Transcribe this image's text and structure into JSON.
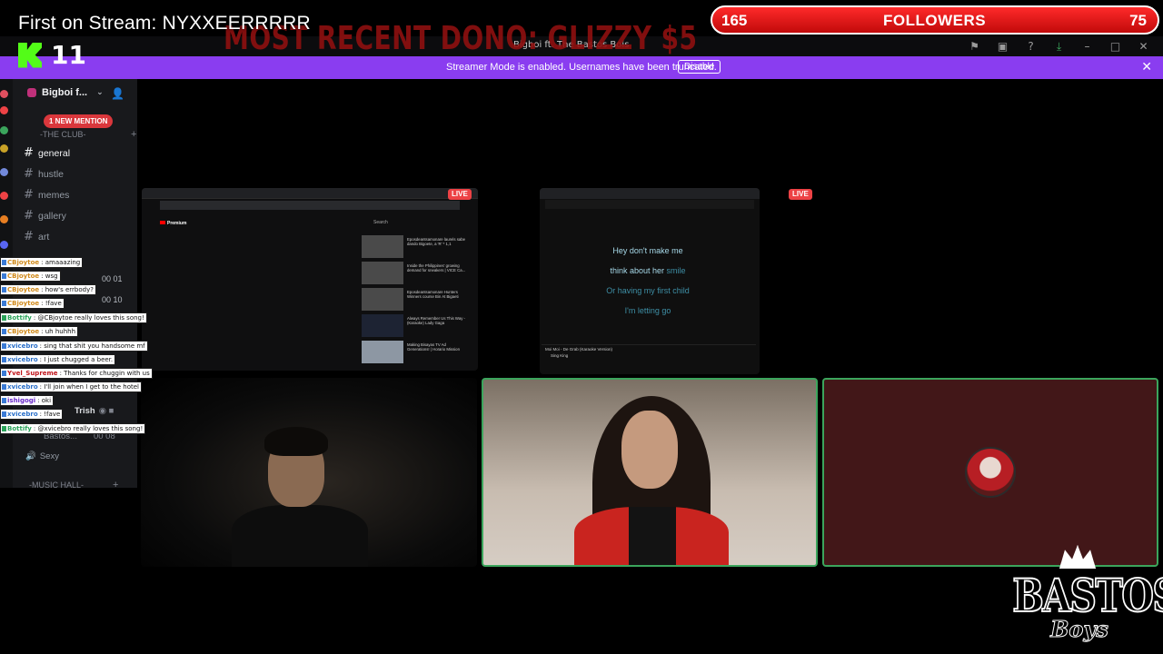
{
  "overlay": {
    "first_on_stream": "First on Stream: NYXXEERRRRR",
    "kick_count": "11",
    "recent_dono": "MOST RECENT DONO: GLIZZY $5",
    "followers": {
      "left": "165",
      "label": "FOLLOWERS",
      "right": "75"
    },
    "logo_big": "BASTOS",
    "logo_small": "Boys"
  },
  "window": {
    "title": "Bigboi ft. The Bastos Bois"
  },
  "streamer_bar": {
    "message": "Streamer Mode is enabled. Usernames have been truncated.",
    "disable_label": "Disable",
    "color": "#8a3df0"
  },
  "sidebar": {
    "server_name": "Bigboi f...",
    "mention_badge": "1 NEW MENTION",
    "categories": [
      {
        "label": "-THE CLUB-"
      },
      {
        "label": "-MUSIC HALL-"
      }
    ],
    "channels": [
      {
        "label": "general",
        "active": true
      },
      {
        "label": "hustle",
        "active": false
      },
      {
        "label": "memes",
        "active": false
      },
      {
        "label": "gallery",
        "active": false
      },
      {
        "label": "art",
        "active": false
      }
    ],
    "voice_users": [
      {
        "label": "Trish"
      },
      {
        "label": "Bastos..."
      },
      {
        "label": "Sexy"
      }
    ],
    "counters": [
      "00 01",
      "00 10",
      "00 08"
    ]
  },
  "chat": [
    {
      "user": "CBjoytoe",
      "text": ": amaaazing"
    },
    {
      "user": "CBjoytoe",
      "text": ": wsg"
    },
    {
      "user": "CBjoytoe",
      "text": ": how's errbody?"
    },
    {
      "user": "CBjoytoe",
      "text": ": !fave"
    },
    {
      "user": "Bottify",
      "text": ": @CBjoytoe really loves this song!"
    },
    {
      "user": "CBjoytoe",
      "text": ": uh huhhh"
    },
    {
      "user": "xvicebro",
      "text": ": sing that shit you handsome mf"
    },
    {
      "user": "xvicebro",
      "text": ": I just chugged a beer."
    },
    {
      "user": "Yvel_Supreme",
      "text": ": Thanks for chuggin with us"
    },
    {
      "user": "xvicebro",
      "text": ": I'll join when I get to the hotel"
    },
    {
      "user": "ishigogi",
      "text": ": oki"
    },
    {
      "user": "xvicebro",
      "text": ": !fave"
    },
    {
      "user": "Bottify",
      "text": ": @xvicebro really loves this song!"
    }
  ],
  "screens": {
    "live_label": "LIVE",
    "screen1": {
      "site": "Premium",
      "search_placeholder": "Search",
      "videos": [
        "Eposdeantsamonare laurels sabe dando Bigoete, a 'R' * 1,1",
        "Inside the Philippines' growing demand for sneakers | VICE Ca...",
        "Eposdeantsamonare Hunters Winners course Bin At Bigaeti",
        "Always Remember Us This Way - (Karaoke) Lady Gaga",
        "Making Bisayas TV Ad Generations! | Horario Mission"
      ]
    },
    "screen2": {
      "lyrics": [
        {
          "main": "Hey don't make me",
          "rest": ""
        },
        {
          "main": "think about her ",
          "rest": "smile"
        },
        {
          "main": "",
          "rest": "Or having my first child"
        },
        {
          "main": "",
          "rest": "I'm letting go"
        }
      ],
      "now_playing": "Moi Moi - De Grab (Karaoke Version)",
      "channel": "Sing King"
    }
  }
}
